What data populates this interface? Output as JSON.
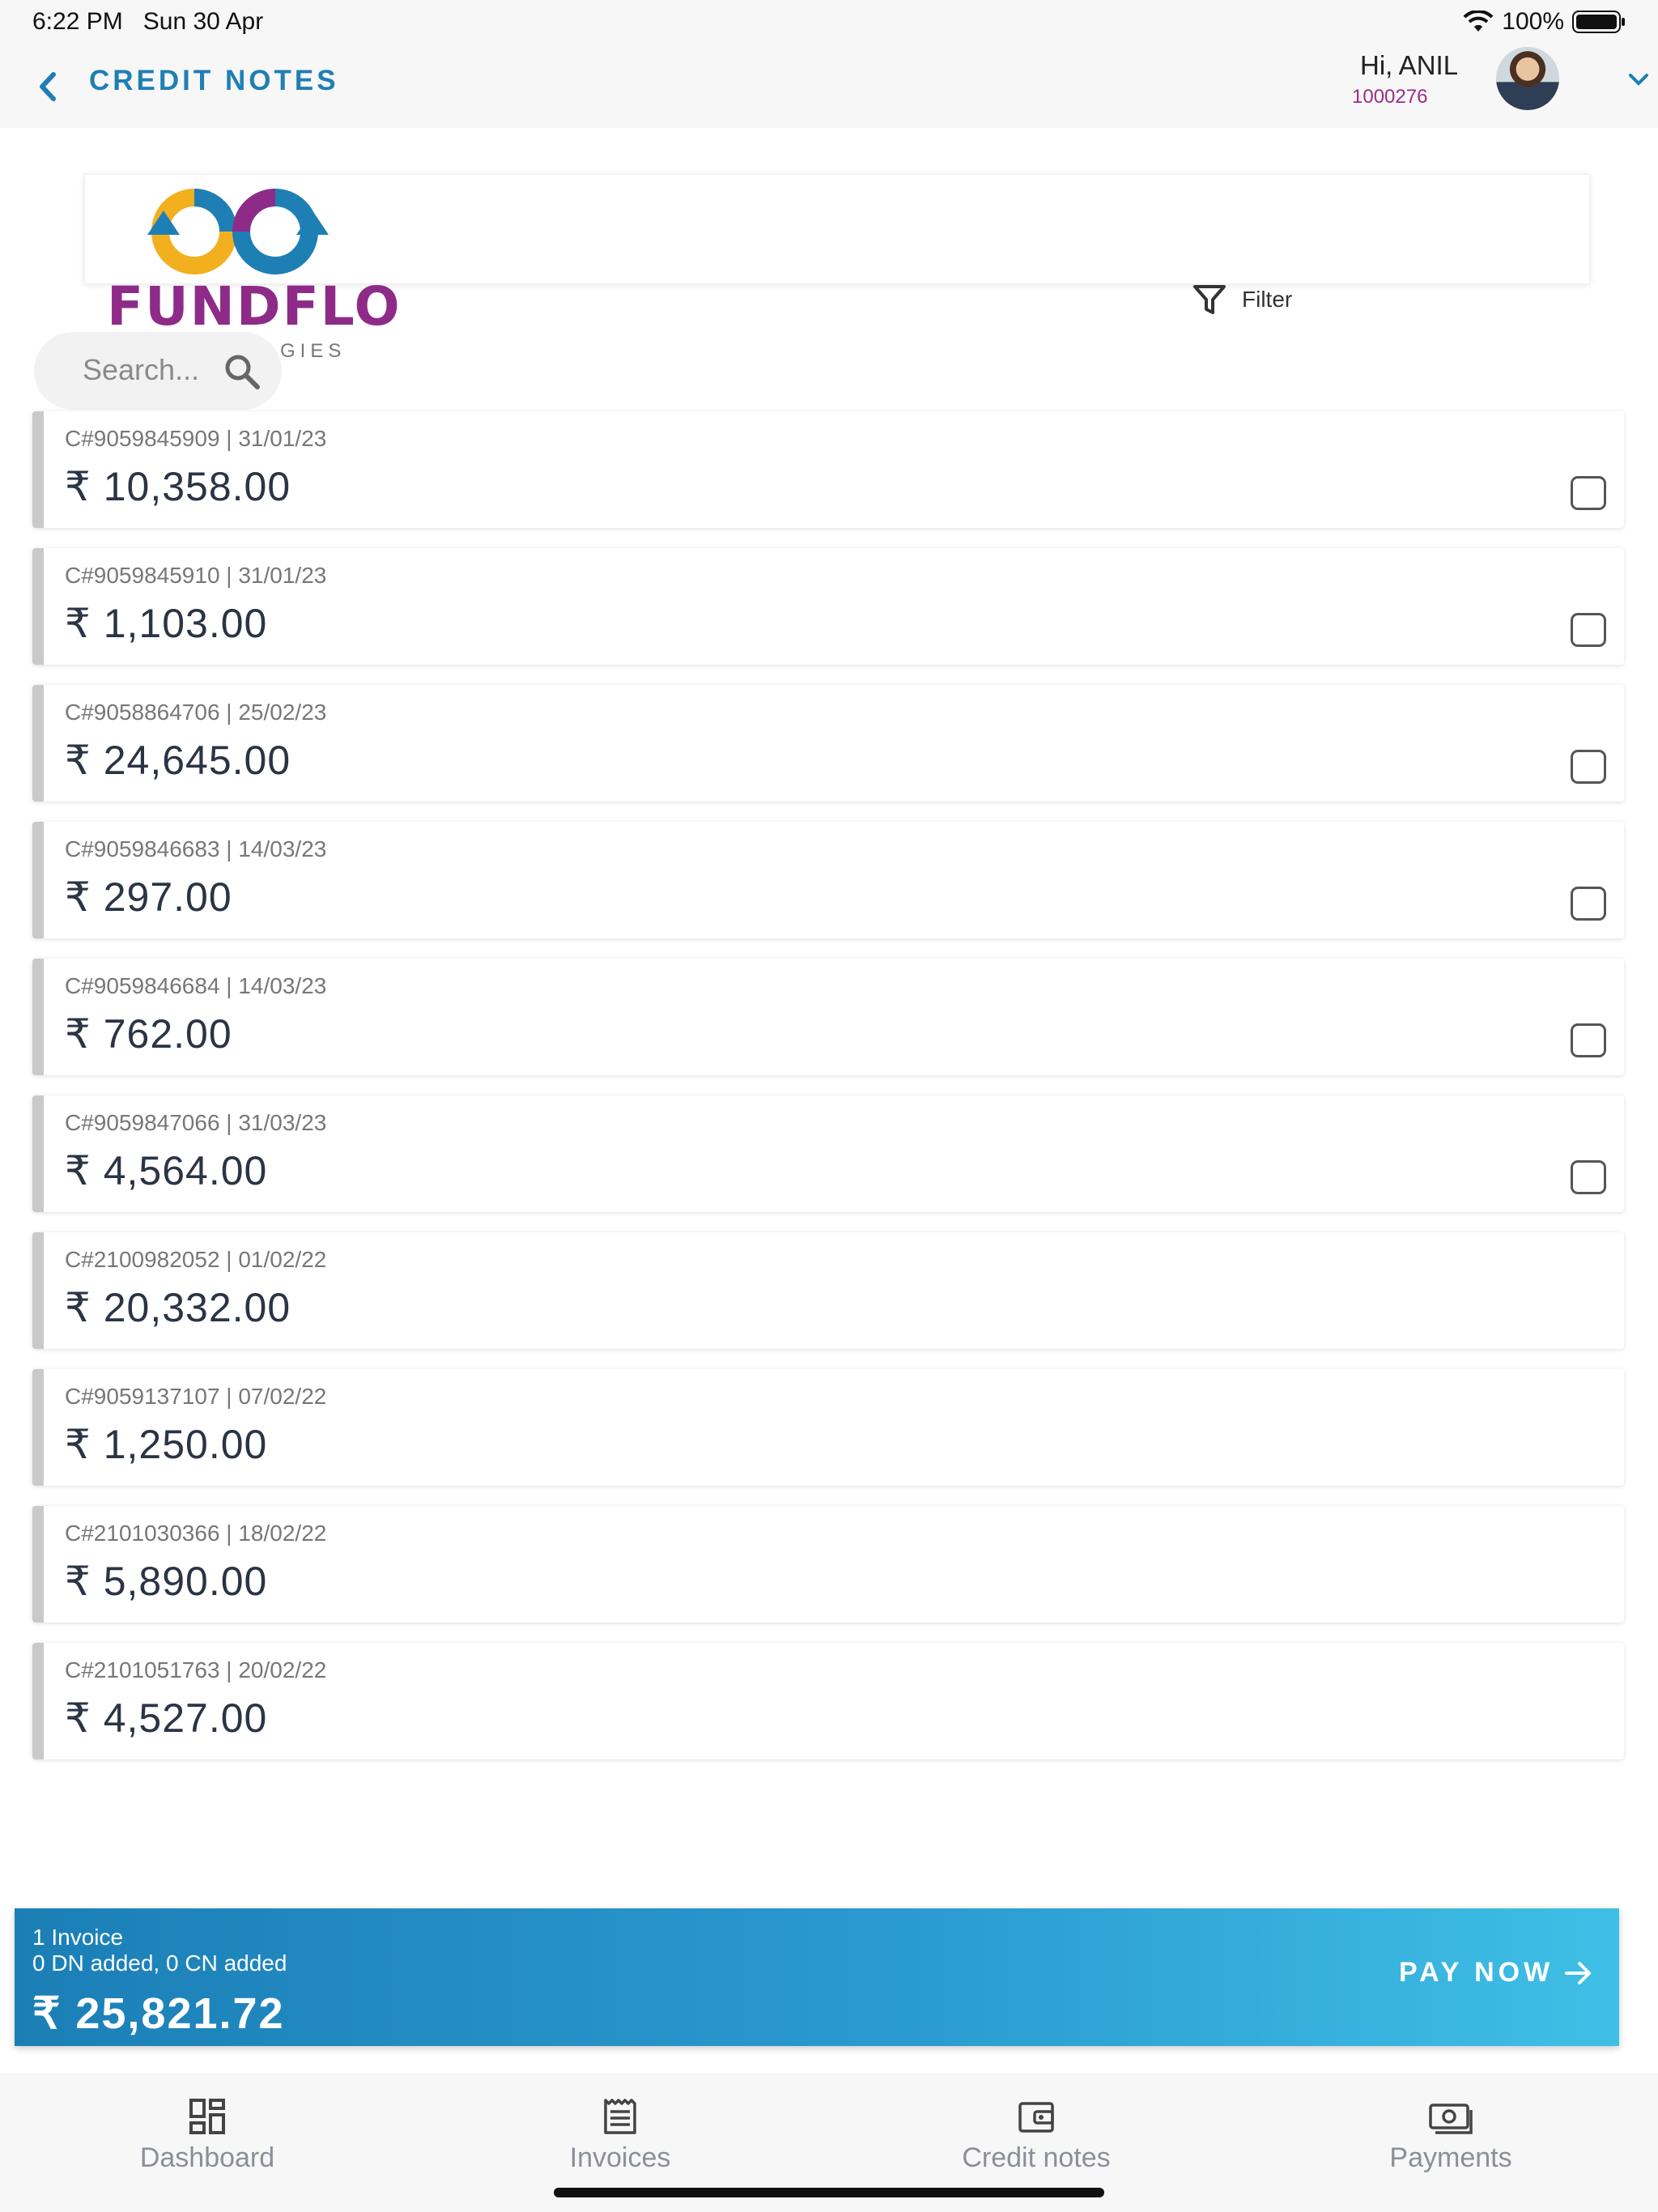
{
  "status_bar": {
    "time": "6:22 PM",
    "date": "Sun 30 Apr",
    "battery": "100%"
  },
  "header": {
    "title": "CREDIT NOTES",
    "greeting": "Hi, ANIL",
    "user_id": "1000276"
  },
  "brand": {
    "name": "FUNDFLO",
    "subtitle_visible": "GIES",
    "colors": {
      "primary": "#8e2b88",
      "blue": "#1e7fb5",
      "yellow": "#f2b01e"
    }
  },
  "filter": {
    "label": "Filter"
  },
  "search": {
    "placeholder": "Search..."
  },
  "credit_notes": [
    {
      "meta": "C#9059845909 | 31/01/23",
      "amount": "₹ 10,358.00",
      "checkbox": true
    },
    {
      "meta": "C#9059845910 | 31/01/23",
      "amount": "₹ 1,103.00",
      "checkbox": true
    },
    {
      "meta": "C#9058864706 | 25/02/23",
      "amount": "₹ 24,645.00",
      "checkbox": true
    },
    {
      "meta": "C#9059846683 | 14/03/23",
      "amount": "₹ 297.00",
      "checkbox": true
    },
    {
      "meta": "C#9059846684 | 14/03/23",
      "amount": "₹ 762.00",
      "checkbox": true
    },
    {
      "meta": "C#9059847066 | 31/03/23",
      "amount": "₹ 4,564.00",
      "checkbox": true
    },
    {
      "meta": "C#2100982052 | 01/02/22",
      "amount": "₹ 20,332.00",
      "checkbox": false
    },
    {
      "meta": "C#9059137107 | 07/02/22",
      "amount": "₹ 1,250.00",
      "checkbox": false
    },
    {
      "meta": "C#2101030366 | 18/02/22",
      "amount": "₹ 5,890.00",
      "checkbox": false
    },
    {
      "meta": "C#2101051763 | 20/02/22",
      "amount": "₹ 4,527.00",
      "checkbox": false
    }
  ],
  "payment_banner": {
    "invoice_count": "1 Invoice",
    "adjustments": "0 DN added, 0 CN added",
    "total": "₹ 25,821.72",
    "action": "PAY NOW"
  },
  "tabs": [
    {
      "label": "Dashboard",
      "icon": "dashboard-icon"
    },
    {
      "label": "Invoices",
      "icon": "invoice-icon"
    },
    {
      "label": "Credit notes",
      "icon": "wallet-icon"
    },
    {
      "label": "Payments",
      "icon": "payments-icon"
    }
  ]
}
